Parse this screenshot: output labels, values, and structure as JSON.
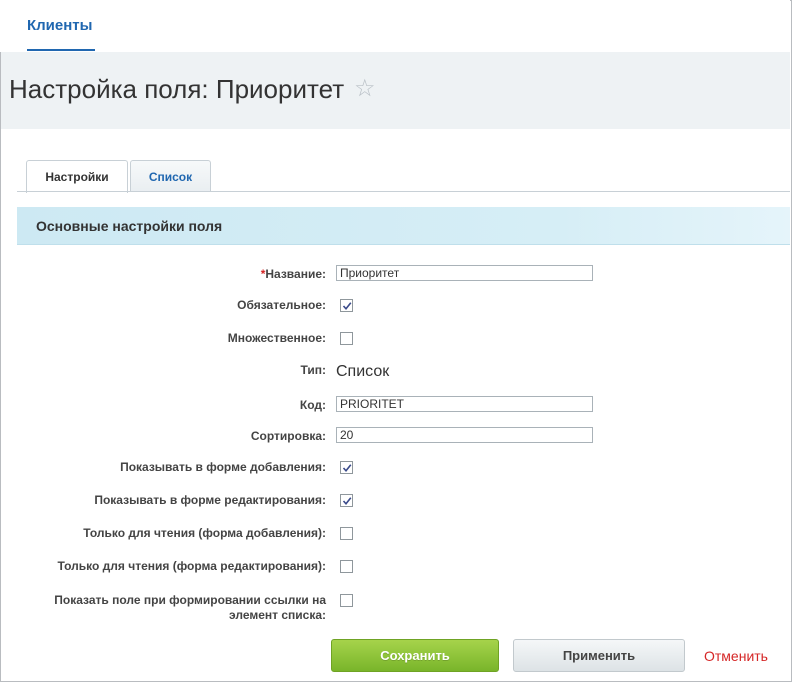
{
  "nav": {
    "item": "Клиенты"
  },
  "header": {
    "title": "Настройка поля: Приоритет",
    "star_icon": "star-outline-icon"
  },
  "tabs": [
    {
      "label": "Настройки",
      "active": true
    },
    {
      "label": "Список",
      "active": false
    }
  ],
  "section": {
    "title": "Основные настройки поля"
  },
  "form": {
    "name": {
      "required_mark": "*",
      "label": "Название:",
      "value": "Приоритет"
    },
    "mandatory": {
      "label": "Обязательное:",
      "checked": true
    },
    "multiple": {
      "label": "Множественное:",
      "checked": false
    },
    "type": {
      "label": "Тип:",
      "value": "Список"
    },
    "code": {
      "label": "Код:",
      "value": "PRIORITET"
    },
    "sort": {
      "label": "Сортировка:",
      "value": "20"
    },
    "show_add": {
      "label": "Показывать в форме добавления:",
      "checked": true
    },
    "show_edit": {
      "label": "Показывать в форме редактирования:",
      "checked": true
    },
    "readonly_add": {
      "label": "Только для чтения (форма добавления):",
      "checked": false
    },
    "readonly_edit": {
      "label": "Только для чтения (форма редактирования):",
      "checked": false
    },
    "show_link": {
      "label_line1": "Показать поле при формировании ссылки на",
      "label_line2": "элемент списка:",
      "checked": false
    }
  },
  "buttons": {
    "save": "Сохранить",
    "apply": "Применить",
    "cancel": "Отменить"
  },
  "colors": {
    "accent": "#2067b0",
    "save_green": "#8cc63f",
    "cancel_red": "#d52626",
    "section_bg": "#d6eef6"
  }
}
